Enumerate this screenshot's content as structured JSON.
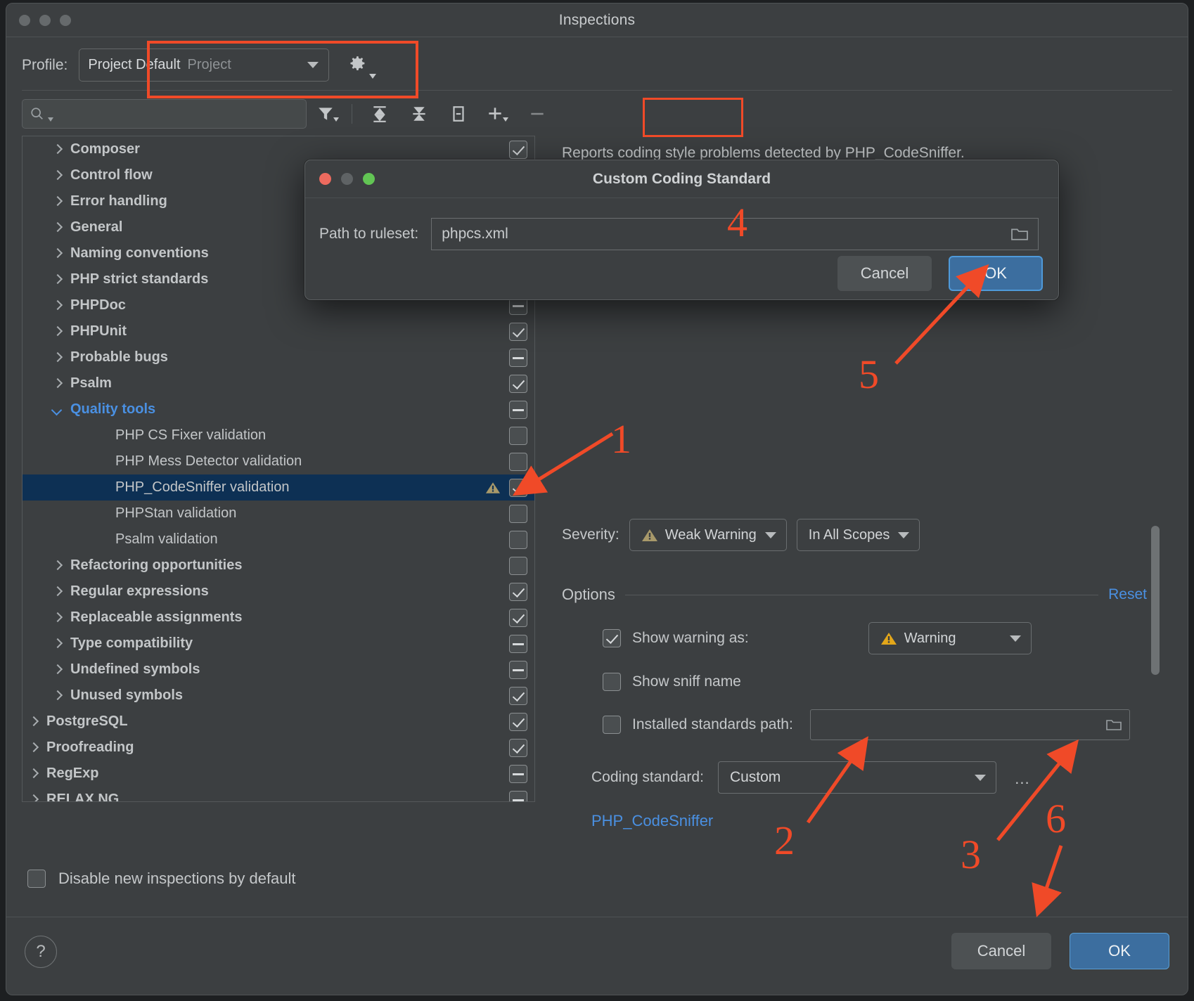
{
  "window": {
    "title": "Inspections"
  },
  "profile": {
    "label": "Profile:",
    "name": "Project Default",
    "scope": "Project",
    "gear_icon": "gear-icon"
  },
  "toolbar": {
    "search_placeholder": "",
    "search_value": "",
    "icons": [
      "filter-icon",
      "expand-all-icon",
      "collapse-all-icon",
      "group-by-severity-icon",
      "add-icon",
      "remove-icon"
    ]
  },
  "tree": {
    "rows": [
      {
        "label": "Composer",
        "indent": 1,
        "arrow": "right",
        "bold": true,
        "check": "checked"
      },
      {
        "label": "Control flow",
        "indent": 1,
        "arrow": "right",
        "bold": true,
        "check": "none"
      },
      {
        "label": "Error handling",
        "indent": 1,
        "arrow": "right",
        "bold": true,
        "check": "none"
      },
      {
        "label": "General",
        "indent": 1,
        "arrow": "right",
        "bold": true,
        "check": "none"
      },
      {
        "label": "Naming conventions",
        "indent": 1,
        "arrow": "right",
        "bold": true,
        "check": "none"
      },
      {
        "label": "PHP strict standards",
        "indent": 1,
        "arrow": "right",
        "bold": true,
        "check": "none"
      },
      {
        "label": "PHPDoc",
        "indent": 1,
        "arrow": "right",
        "bold": true,
        "check": "partial"
      },
      {
        "label": "PHPUnit",
        "indent": 1,
        "arrow": "right",
        "bold": true,
        "check": "checked"
      },
      {
        "label": "Probable bugs",
        "indent": 1,
        "arrow": "right",
        "bold": true,
        "check": "partial"
      },
      {
        "label": "Psalm",
        "indent": 1,
        "arrow": "right",
        "bold": true,
        "check": "checked"
      },
      {
        "label": "Quality tools",
        "indent": 1,
        "arrow": "down",
        "bold": true,
        "blue": true,
        "check": "partial"
      },
      {
        "label": "PHP CS Fixer validation",
        "indent": 2,
        "arrow": "none",
        "check": "unchecked"
      },
      {
        "label": "PHP Mess Detector validation",
        "indent": 2,
        "arrow": "none",
        "check": "unchecked"
      },
      {
        "label": "PHP_CodeSniffer validation",
        "indent": 2,
        "arrow": "none",
        "check": "checked",
        "selected": true,
        "warning_icon": "warning-triangle-icon"
      },
      {
        "label": "PHPStan validation",
        "indent": 2,
        "arrow": "none",
        "check": "unchecked"
      },
      {
        "label": "Psalm validation",
        "indent": 2,
        "arrow": "none",
        "check": "unchecked"
      },
      {
        "label": "Refactoring opportunities",
        "indent": 1,
        "arrow": "right",
        "bold": true,
        "check": "unchecked"
      },
      {
        "label": "Regular expressions",
        "indent": 1,
        "arrow": "right",
        "bold": true,
        "check": "checked"
      },
      {
        "label": "Replaceable assignments",
        "indent": 1,
        "arrow": "right",
        "bold": true,
        "check": "checked"
      },
      {
        "label": "Type compatibility",
        "indent": 1,
        "arrow": "right",
        "bold": true,
        "check": "partial"
      },
      {
        "label": "Undefined symbols",
        "indent": 1,
        "arrow": "right",
        "bold": true,
        "check": "partial"
      },
      {
        "label": "Unused symbols",
        "indent": 1,
        "arrow": "right",
        "bold": true,
        "check": "checked"
      },
      {
        "label": "PostgreSQL",
        "indent": 0,
        "arrow": "right",
        "bold": true,
        "check": "checked"
      },
      {
        "label": "Proofreading",
        "indent": 0,
        "arrow": "right",
        "bold": true,
        "check": "checked"
      },
      {
        "label": "RegExp",
        "indent": 0,
        "arrow": "right",
        "bold": true,
        "check": "partial"
      },
      {
        "label": "RELAX NG",
        "indent": 0,
        "arrow": "right",
        "bold": true,
        "check": "partial"
      }
    ]
  },
  "details": {
    "description": "Reports coding style problems detected by PHP_CodeSniffer.",
    "severity_label": "Severity:",
    "severity_value": "Weak Warning",
    "severity_icon": "warning-triangle-icon",
    "scope_value": "In All Scopes",
    "options_title": "Options",
    "reset_label": "Reset",
    "show_warning_as_label": "Show warning as:",
    "show_warning_as_checked": true,
    "show_warning_as_value": "Warning",
    "show_warning_as_icon": "warning-triangle-icon",
    "show_sniff_name_label": "Show sniff name",
    "show_sniff_name_checked": false,
    "installed_standards_label": "Installed standards path:",
    "installed_standards_checked": false,
    "installed_standards_value": "",
    "installed_standards_icon": "folder-icon",
    "coding_standard_label": "Coding standard:",
    "coding_standard_value": "Custom",
    "ellipsis_button_label": "...",
    "php_codesniffer_link": "PHP_CodeSniffer"
  },
  "footer": {
    "disable_new_label": "Disable new inspections by default",
    "disable_new_checked": false,
    "help_label": "?",
    "cancel_label": "Cancel",
    "ok_label": "OK"
  },
  "modal": {
    "title": "Custom Coding Standard",
    "path_label": "Path to ruleset:",
    "path_value": "phpcs.xml",
    "browse_icon": "folder-icon",
    "cancel_label": "Cancel",
    "ok_label": "OK"
  },
  "annotations": {
    "accent_color": "#f04a28",
    "markers": [
      {
        "id": "1",
        "label": "1"
      },
      {
        "id": "2",
        "label": "2"
      },
      {
        "id": "3",
        "label": "3"
      },
      {
        "id": "4",
        "label": "4"
      },
      {
        "id": "5",
        "label": "5"
      },
      {
        "id": "6",
        "label": "6"
      }
    ]
  }
}
